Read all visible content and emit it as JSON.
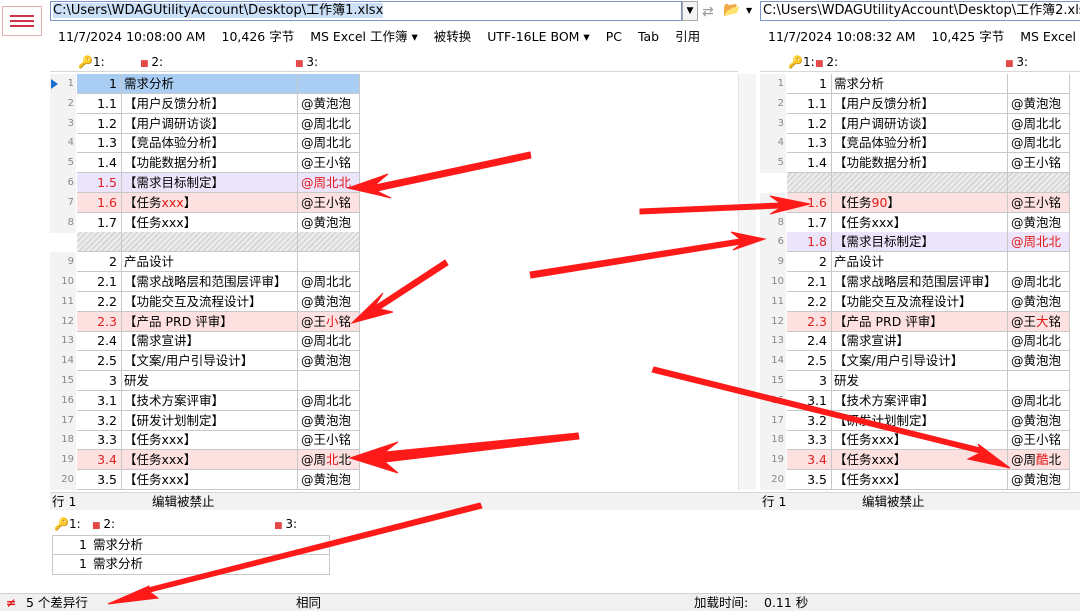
{
  "left": {
    "path": "C:\\Users\\WDAGUtilityAccount\\Desktop\\工作簿1.xlsx",
    "info": [
      "11/7/2024 10:08:00 AM",
      "10,426 字节",
      "MS Excel 工作簿 ▾",
      "被转换",
      "UTF-16LE BOM ▾",
      "PC",
      "Tab",
      "引用"
    ],
    "col1": "1:",
    "col2": "2:",
    "col3": "3:",
    "status_left": "行 1",
    "status_mid": "编辑被禁止",
    "rows": [
      {
        "ln": "1",
        "num": "1",
        "t": "需求分析",
        "o": ""
      },
      {
        "ln": "2",
        "num": "1.1",
        "t": "【用户反馈分析】",
        "o": "@黄泡泡"
      },
      {
        "ln": "3",
        "num": "1.2",
        "t": "【用户调研访谈】",
        "o": "@周北北"
      },
      {
        "ln": "4",
        "num": "1.3",
        "t": "【竞品体验分析】",
        "o": "@周北北"
      },
      {
        "ln": "5",
        "num": "1.4",
        "t": "【功能数据分析】",
        "o": "@王小铭"
      },
      {
        "ln": "6",
        "num": "1.5",
        "t": "【需求目标制定】",
        "o": "@周北北"
      },
      {
        "ln": "7",
        "num": "1.6",
        "t": "【任务",
        "tr": "xxx",
        "t2": "】",
        "o": "@王小铭"
      },
      {
        "ln": "8",
        "num": "1.7",
        "t": "【任务xxx】",
        "o": "@黄泡泡"
      },
      {
        "ln": "",
        "num": "",
        "t": "",
        "o": ""
      },
      {
        "ln": "9",
        "num": "2",
        "t": "产品设计",
        "o": ""
      },
      {
        "ln": "10",
        "num": "2.1",
        "t": "【需求战略层和范围层评审】",
        "o": "@周北北"
      },
      {
        "ln": "11",
        "num": "2.2",
        "t": "【功能交互及流程设计】",
        "o": "@黄泡泡"
      },
      {
        "ln": "12",
        "num": "2.3",
        "t": "【产品 PRD 评审】",
        "o": "@王",
        "or": "小",
        "o2": "铭"
      },
      {
        "ln": "13",
        "num": "2.4",
        "t": "【需求宣讲】",
        "o": "@周北北"
      },
      {
        "ln": "14",
        "num": "2.5",
        "t": "【文案/用户引导设计】",
        "o": "@黄泡泡"
      },
      {
        "ln": "15",
        "num": "3",
        "t": "研发",
        "o": ""
      },
      {
        "ln": "16",
        "num": "3.1",
        "t": "【技术方案评审】",
        "o": "@周北北"
      },
      {
        "ln": "17",
        "num": "3.2",
        "t": "【研发计划制定】",
        "o": "@黄泡泡"
      },
      {
        "ln": "18",
        "num": "3.3",
        "t": "【任务xxx】",
        "o": "@王小铭"
      },
      {
        "ln": "19",
        "num": "3.4",
        "t": "【任务xxx】",
        "o": "@周",
        "or": "北",
        "o2": "北"
      },
      {
        "ln": "20",
        "num": "3.5",
        "t": "【任务xxx】",
        "o": "@黄泡泡"
      }
    ]
  },
  "right": {
    "path": "C:\\Users\\WDAGUtilityAccount\\Desktop\\工作簿2.xlsx",
    "info": [
      "11/7/2024 10:08:32 AM",
      "10,425 字节",
      "MS Excel"
    ],
    "col1": "1:",
    "col2": "2:",
    "col3": "3:",
    "status_left": "行 1",
    "status_mid": "编辑被禁止",
    "rows": [
      {
        "ln": "1",
        "num": "1",
        "t": "需求分析",
        "o": ""
      },
      {
        "ln": "2",
        "num": "1.1",
        "t": "【用户反馈分析】",
        "o": "@黄泡泡"
      },
      {
        "ln": "3",
        "num": "1.2",
        "t": "【用户调研访谈】",
        "o": "@周北北"
      },
      {
        "ln": "4",
        "num": "1.3",
        "t": "【竞品体验分析】",
        "o": "@周北北"
      },
      {
        "ln": "5",
        "num": "1.4",
        "t": "【功能数据分析】",
        "o": "@王小铭"
      },
      {
        "ln": "",
        "num": "",
        "t": "",
        "o": ""
      },
      {
        "ln": "7",
        "num": "1.6",
        "t": "【任务",
        "tr": "90",
        "t2": "】",
        "o": "@王小铭"
      },
      {
        "ln": "8",
        "num": "1.7",
        "t": "【任务xxx】",
        "o": "@黄泡泡"
      },
      {
        "ln": "6",
        "num": "1.8",
        "t": "【需求目标制定】",
        "o": "@周北北"
      },
      {
        "ln": "9",
        "num": "2",
        "t": "产品设计",
        "o": ""
      },
      {
        "ln": "10",
        "num": "2.1",
        "t": "【需求战略层和范围层评审】",
        "o": "@周北北"
      },
      {
        "ln": "11",
        "num": "2.2",
        "t": "【功能交互及流程设计】",
        "o": "@黄泡泡"
      },
      {
        "ln": "12",
        "num": "2.3",
        "t": "【产品 PRD 评审】",
        "o": "@王",
        "or": "大",
        "o2": "铭"
      },
      {
        "ln": "13",
        "num": "2.4",
        "t": "【需求宣讲】",
        "o": "@周北北"
      },
      {
        "ln": "14",
        "num": "2.5",
        "t": "【文案/用户引导设计】",
        "o": "@黄泡泡"
      },
      {
        "ln": "15",
        "num": "3",
        "t": "研发",
        "o": ""
      },
      {
        "ln": "16",
        "num": "3.1",
        "t": "【技术方案评审】",
        "o": "@周北北"
      },
      {
        "ln": "17",
        "num": "3.2",
        "t": "【研发计划制定】",
        "o": "@黄泡泡"
      },
      {
        "ln": "18",
        "num": "3.3",
        "t": "【任务xxx】",
        "o": "@王小铭"
      },
      {
        "ln": "19",
        "num": "3.4",
        "t": "【任务xxx】",
        "o": "@周",
        "or": "酷",
        "o2": "北"
      },
      {
        "ln": "20",
        "num": "3.5",
        "t": "【任务xxx】",
        "o": "@黄泡泡"
      }
    ]
  },
  "detail": {
    "col1": "1:",
    "col2": "2:",
    "col3": "3:",
    "rows": [
      {
        "num": "1",
        "t": "需求分析"
      },
      {
        "num": "1",
        "t": "需求分析"
      }
    ]
  },
  "status": {
    "diff_count": "5 个差异行",
    "same": "相同",
    "load_label": "加载时间:",
    "load_value": "0.11 秒"
  },
  "colors": {
    "diff_bg": "#fde0e0",
    "moved_bg": "#ece4fb",
    "arrow": "#ff1a1a",
    "header_bg": "#a9cdf3"
  }
}
